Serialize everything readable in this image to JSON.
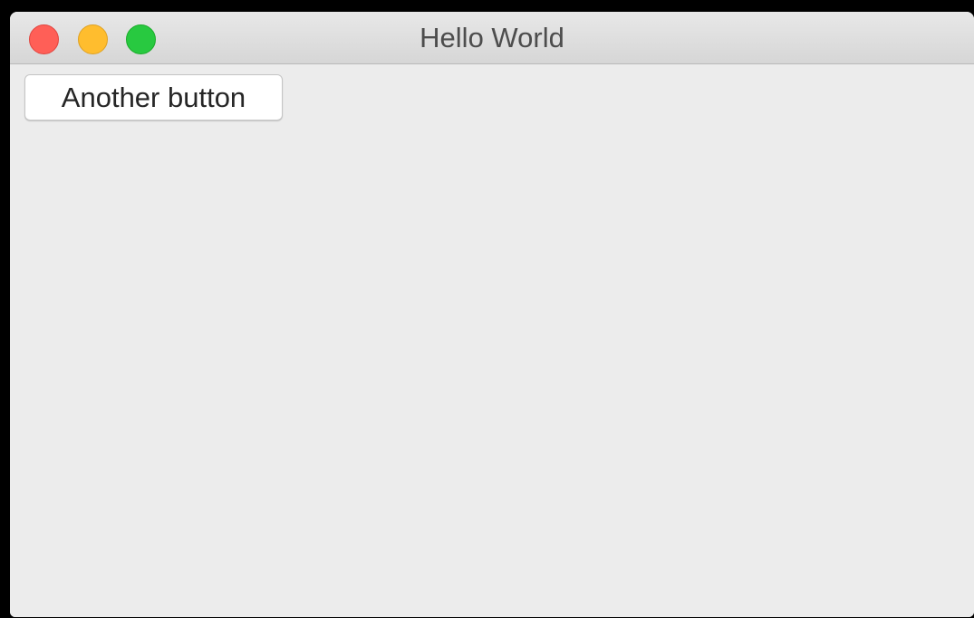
{
  "window": {
    "title": "Hello World"
  },
  "traffic_lights": {
    "close_color": "#ff5f57",
    "close_border": "#e0443e",
    "minimize_color": "#ffbd2e",
    "minimize_border": "#dea123",
    "zoom_color": "#28c940",
    "zoom_border": "#1aab29"
  },
  "content": {
    "button_label": "Another button"
  }
}
